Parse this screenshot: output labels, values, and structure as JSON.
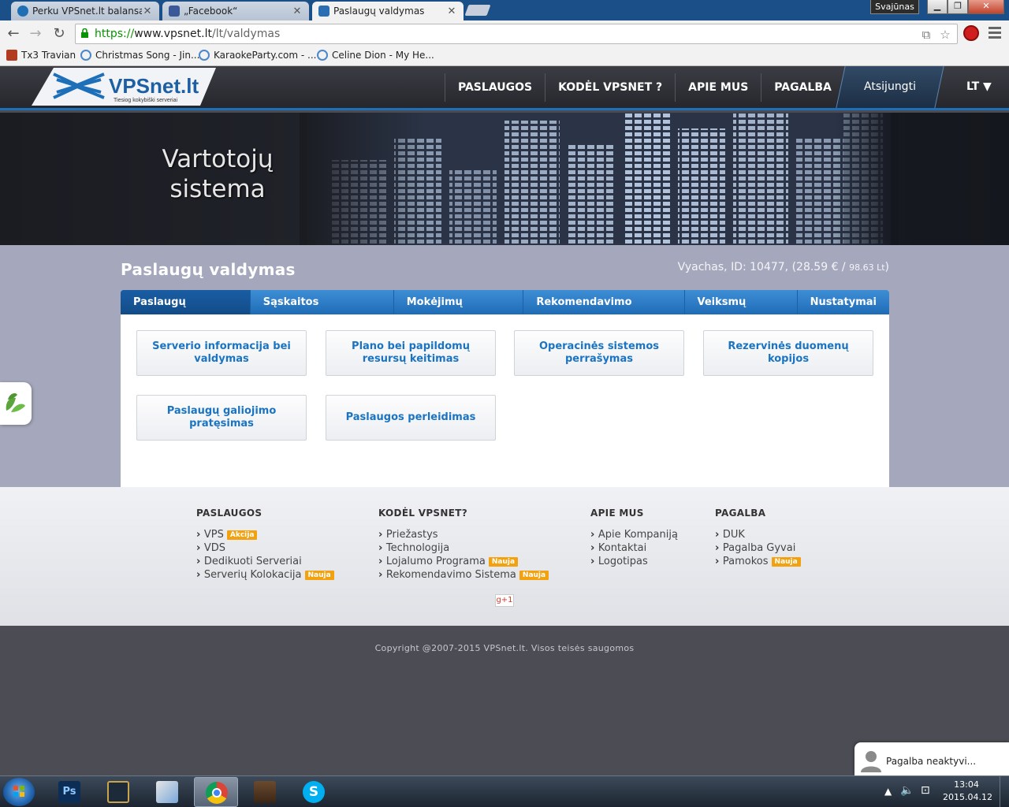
{
  "browser": {
    "tabs": [
      {
        "label": "Perku VPSnet.lt balansą/p",
        "active": false
      },
      {
        "label": "„Facebook“",
        "active": false
      },
      {
        "label": "Paslaugų valdymas",
        "active": true
      }
    ],
    "profile_name": "Svajūnas",
    "url_scheme": "https://",
    "url_host": "www.vpsnet.lt",
    "url_path": "/lt/valdymas",
    "bookmarks": [
      {
        "label": "Tx3 Travian"
      },
      {
        "label": "Christmas Song - Jin..."
      },
      {
        "label": "KaraokeParty.com - ..."
      },
      {
        "label": "Celine Dion - My He..."
      }
    ]
  },
  "site": {
    "logo_text": "VPSnet.lt",
    "logo_tagline": "Tiesiog kokybiški serveriai",
    "nav": [
      "PASLAUGOS",
      "KODĖL VPSNET ?",
      "APIE MUS",
      "PAGALBA"
    ],
    "logout_label": "Atsijungti",
    "lang_label": "LT ▼",
    "banner_title": "Vartotojų sistema"
  },
  "main": {
    "page_title": "Paslaugų valdymas",
    "user_info_prefix": "Vyachas, ID: 10477, (28.59 € / ",
    "user_info_lt": "98.63 Lt",
    "user_info_suffix": ")",
    "tabs": [
      {
        "label": "Paslaugų valdymas",
        "active": true
      },
      {
        "label": "Sąskaitos papildymas",
        "active": false
      },
      {
        "label": "Mokėjimų sistemos",
        "active": false
      },
      {
        "label": "Rekomendavimo sistema",
        "active": false
      },
      {
        "label": "Veiksmų istorija",
        "active": false
      },
      {
        "label": "Nustatymai",
        "active": false
      }
    ],
    "service_buttons": [
      "Serverio informacija bei valdymas",
      "Plano bei papildomų resursų keitimas",
      "Operacinės sistemos perrašymas",
      "Rezervinės duomenų kopijos",
      "Paslaugų galiojimo pratęsimas",
      "Paslaugos perleidimas"
    ]
  },
  "footer": {
    "columns": [
      {
        "heading": "PASLAUGOS",
        "items": [
          {
            "label": "VPS",
            "badge": "Akcija"
          },
          {
            "label": "VDS",
            "badge": ""
          },
          {
            "label": "Dedikuoti Serveriai",
            "badge": ""
          },
          {
            "label": "Serverių Kolokacija",
            "badge": "Nauja"
          }
        ]
      },
      {
        "heading": "KODĖL VPSNET?",
        "items": [
          {
            "label": "Priežastys",
            "badge": ""
          },
          {
            "label": "Technologija",
            "badge": ""
          },
          {
            "label": "Lojalumo Programa",
            "badge": "Nauja"
          },
          {
            "label": "Rekomendavimo Sistema",
            "badge": "Nauja"
          }
        ]
      },
      {
        "heading": "APIE MUS",
        "items": [
          {
            "label": "Apie Kompaniją",
            "badge": ""
          },
          {
            "label": "Kontaktai",
            "badge": ""
          },
          {
            "label": "Logotipas",
            "badge": ""
          }
        ]
      },
      {
        "heading": "PAGALBA",
        "items": [
          {
            "label": "DUK",
            "badge": ""
          },
          {
            "label": "Pagalba Gyvai",
            "badge": ""
          },
          {
            "label": "Pamokos",
            "badge": "Nauja"
          }
        ]
      }
    ],
    "gplus_label": "g+1",
    "copyright": "Copyright @2007-2015 VPSnet.lt. Visos teisės saugomos",
    "chat_label": "Pagalba neaktyvi..."
  },
  "taskbar": {
    "time": "13:04",
    "date": "2015.04.12",
    "apps": [
      "start-icon",
      "photoshop-icon",
      "league-icon",
      "pen-app-icon",
      "chrome-icon",
      "game-icon",
      "skype-icon"
    ]
  },
  "colors": {
    "accent_blue": "#1e6cb6",
    "link_blue": "#1a74c2",
    "badge_orange": "#f2a20f",
    "https_green": "#079400"
  }
}
